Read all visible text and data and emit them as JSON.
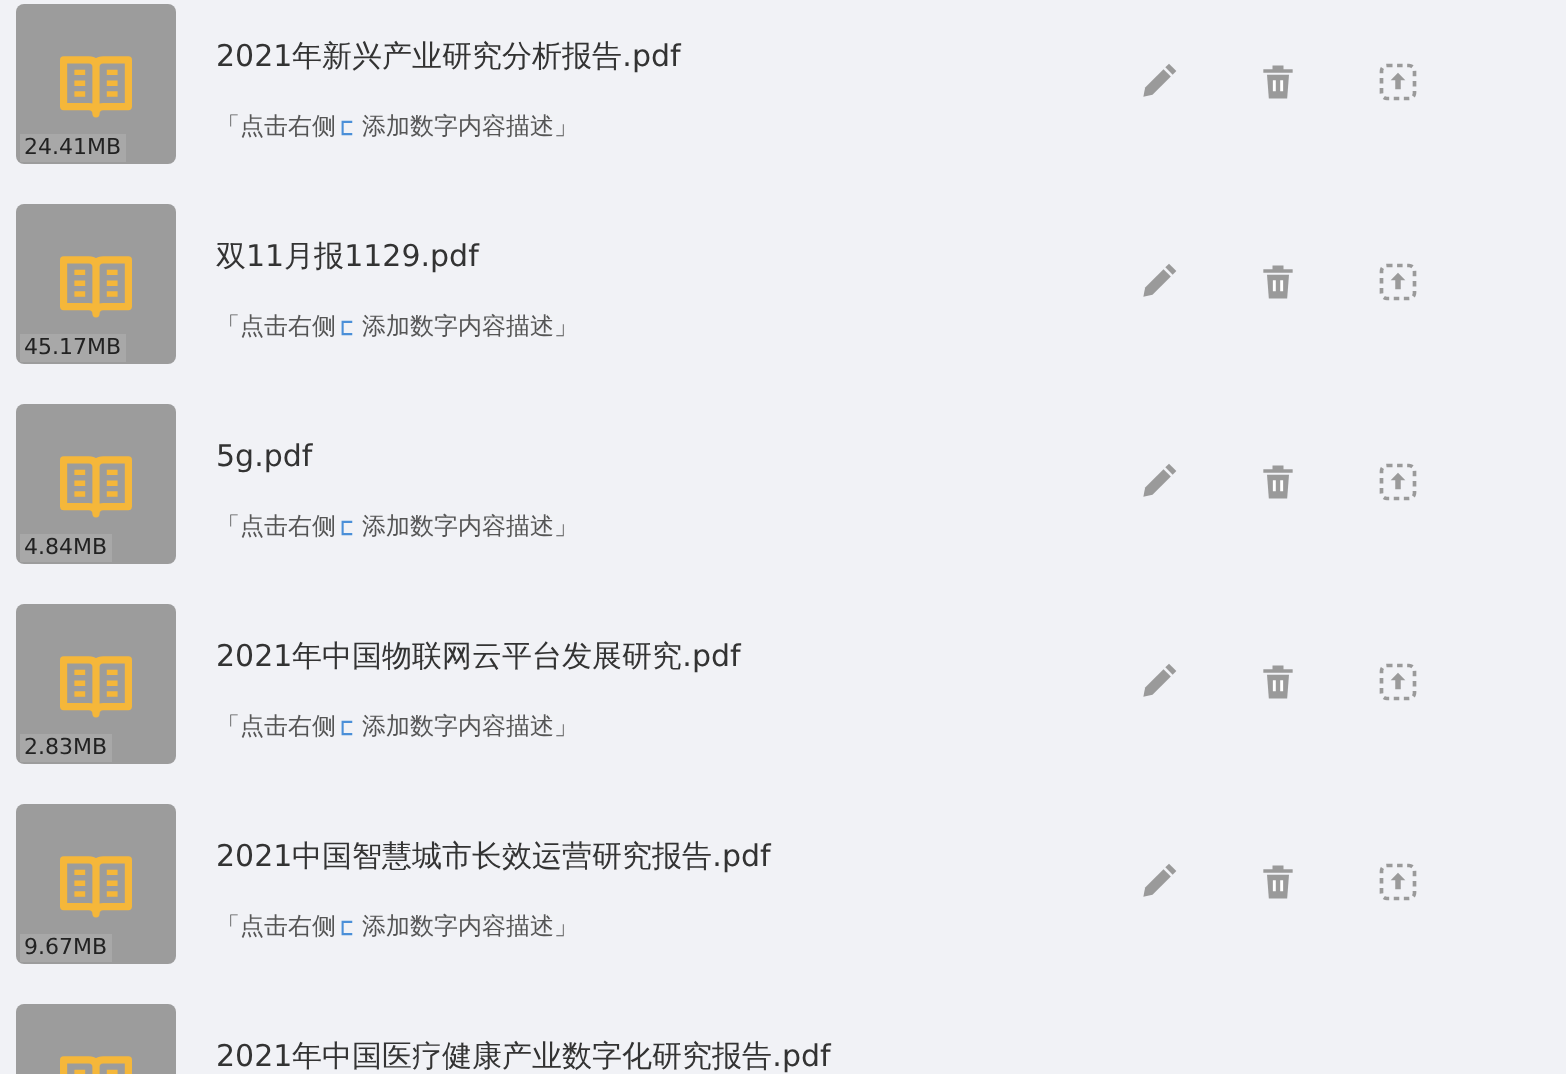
{
  "files": [
    {
      "title": "2021年新兴产业研究分析报告.pdf",
      "size": "24.41MB",
      "hint_before": "「点击右侧",
      "hint_after": "添加数字内容描述」"
    },
    {
      "title": "双11月报1129.pdf",
      "size": "45.17MB",
      "hint_before": "「点击右侧",
      "hint_after": "添加数字内容描述」"
    },
    {
      "title": "5g.pdf",
      "size": "4.84MB",
      "hint_before": "「点击右侧",
      "hint_after": "添加数字内容描述」"
    },
    {
      "title": "2021年中国物联网云平台发展研究.pdf",
      "size": "2.83MB",
      "hint_before": "「点击右侧",
      "hint_after": "添加数字内容描述」"
    },
    {
      "title": "2021中国智慧城市长效运营研究报告.pdf",
      "size": "9.67MB",
      "hint_before": "「点击右侧",
      "hint_after": "添加数字内容描述」"
    },
    {
      "title": "2021年中国医疗健康产业数字化研究报告.pdf"
    }
  ]
}
